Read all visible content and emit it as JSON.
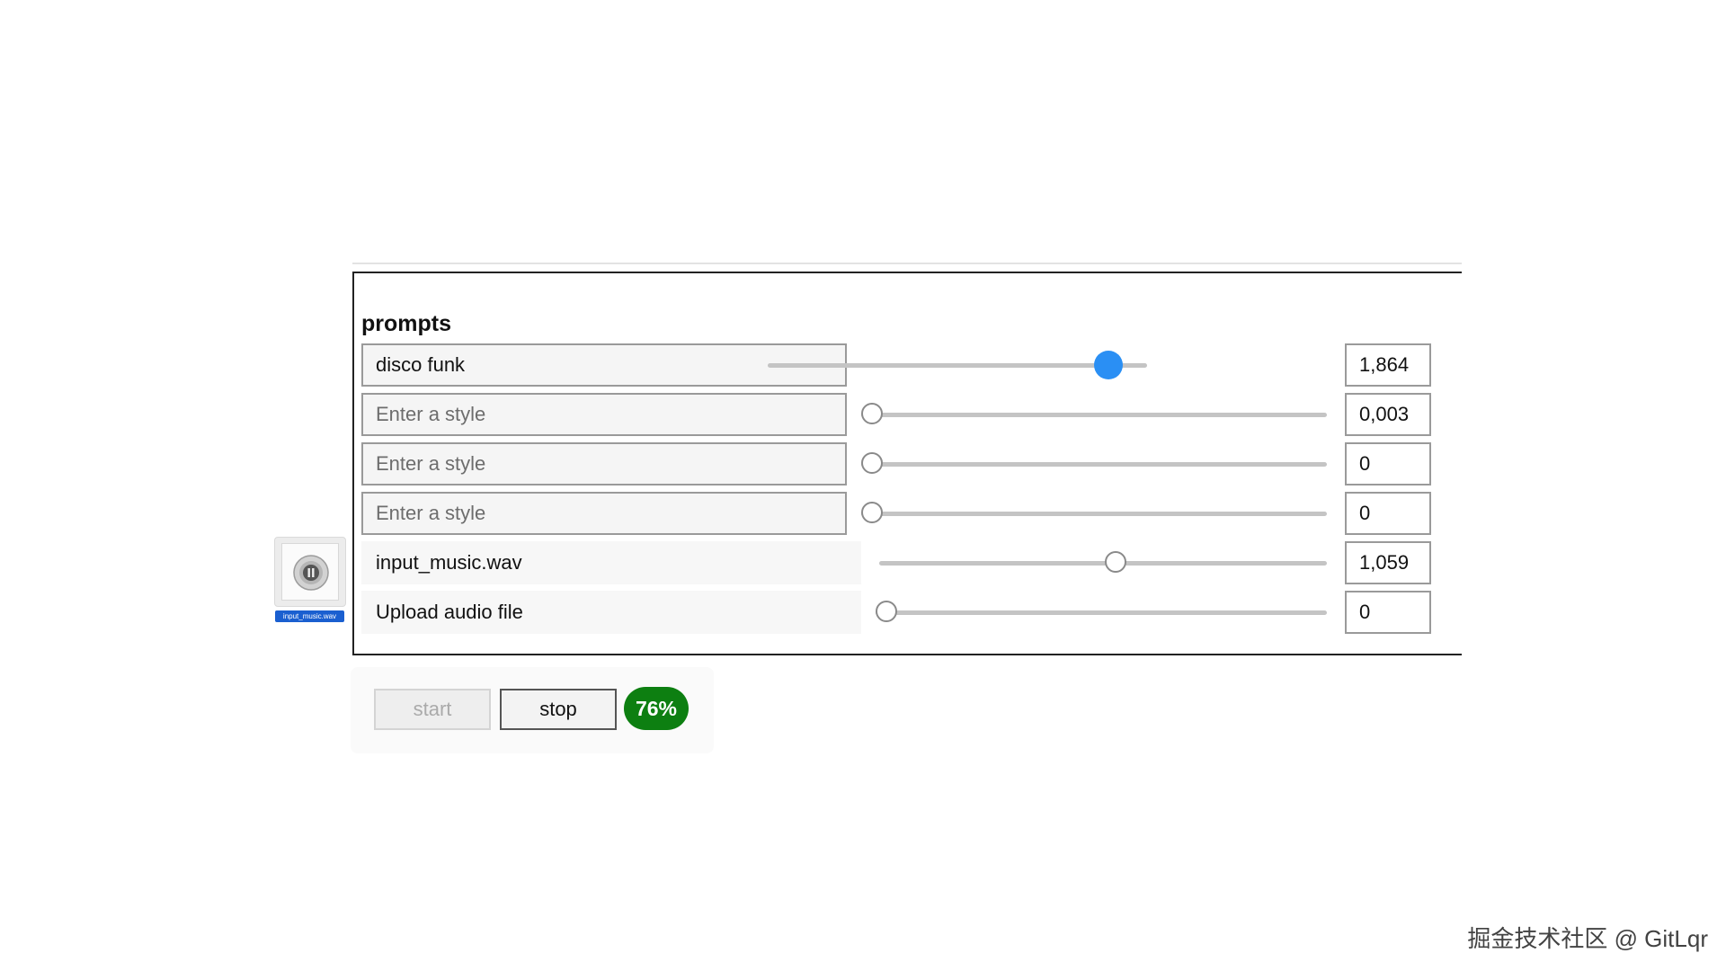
{
  "panel": {
    "title": "prompts"
  },
  "prompt_rows": [
    {
      "kind": "text",
      "value": "disco funk",
      "placeholder": "Enter a style",
      "weight_display": "1,864",
      "slider_fraction": 0.93,
      "active": true
    },
    {
      "kind": "text",
      "value": "",
      "placeholder": "Enter a style",
      "weight_display": "0,003",
      "slider_fraction": 0.0,
      "active": false
    },
    {
      "kind": "text",
      "value": "",
      "placeholder": "Enter a style",
      "weight_display": "0",
      "slider_fraction": 0.0,
      "active": false
    },
    {
      "kind": "text",
      "value": "",
      "placeholder": "Enter a style",
      "weight_display": "0",
      "slider_fraction": 0.0,
      "active": false
    },
    {
      "kind": "audio",
      "label": "input_music.wav",
      "weight_display": "1,059",
      "slider_fraction": 0.53,
      "active": false
    },
    {
      "kind": "audio",
      "label": "Upload audio file",
      "weight_display": "0",
      "slider_fraction": 0.0,
      "active": false
    }
  ],
  "controls": {
    "start_label": "start",
    "stop_label": "stop",
    "progress_label": "76%",
    "progress_value": 0.76
  },
  "desktop_file": {
    "icon": "audio-file-icon",
    "name": "input_music.wav"
  },
  "watermark": "掘金技术社区 @ GitLqr",
  "colors": {
    "slider_active": "#2a8ff4",
    "progress_badge": "#0d7f11",
    "file_label_bg": "#1a5fd0"
  }
}
